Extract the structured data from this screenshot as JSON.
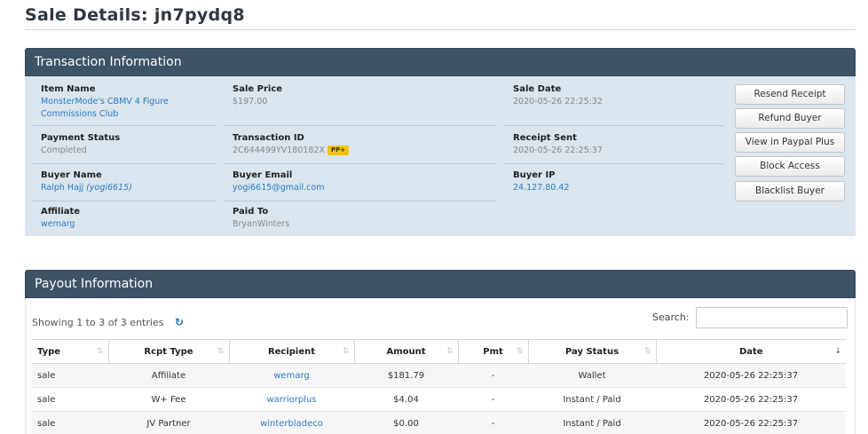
{
  "page": {
    "title": "Sale Details: jn7pydq8"
  },
  "transaction": {
    "header": "Transaction Information",
    "item_name": {
      "label": "Item Name",
      "value": "MonsterMode's CBMV 4 Figure Commissions Club"
    },
    "sale_price": {
      "label": "Sale Price",
      "value": "$197.00"
    },
    "sale_date": {
      "label": "Sale Date",
      "value": "2020-05-26 22:25:32"
    },
    "payment_status": {
      "label": "Payment Status",
      "value": "Completed"
    },
    "transaction_id": {
      "label": "Transaction ID",
      "value": "2C644499YV180182X",
      "badge": "PP+"
    },
    "receipt_sent": {
      "label": "Receipt Sent",
      "value": "2020-05-26 22:25:37"
    },
    "buyer_name": {
      "label": "Buyer Name",
      "value": "Ralph Hajj",
      "username": "(yogi6615)"
    },
    "buyer_email": {
      "label": "Buyer Email",
      "value": "yogi6615@gmail.com"
    },
    "buyer_ip": {
      "label": "Buyer IP",
      "value": "24.127.80.42"
    },
    "affiliate": {
      "label": "Affiliate",
      "value": "wemarg"
    },
    "paid_to": {
      "label": "Paid To",
      "value": "BryanWinters"
    },
    "actions": {
      "resend_receipt": "Resend Receipt",
      "refund_buyer": "Refund Buyer",
      "view_paypal_plus": "View in Paypal Plus",
      "block_access": "Block Access",
      "blacklist_buyer": "Blacklist Buyer"
    }
  },
  "payout": {
    "header": "Payout Information",
    "showing_text": "Showing 1 to 3 of 3 entries",
    "search_label": "Search:",
    "search_value": "",
    "columns": [
      "Type",
      "Rcpt Type",
      "Recipient",
      "Amount",
      "Pmt",
      "Pay Status",
      "Date"
    ],
    "rows": [
      {
        "type": "sale",
        "rcpt_type": "Affiliate",
        "recipient": "wemarg",
        "amount": "$181.79",
        "pmt": "-",
        "pay_status": "Wallet",
        "date": "2020-05-26 22:25:37"
      },
      {
        "type": "sale",
        "rcpt_type": "W+ Fee",
        "recipient": "warriorplus",
        "amount": "$4.04",
        "pmt": "-",
        "pay_status": "Instant / Paid",
        "date": "2020-05-26 22:25:37"
      },
      {
        "type": "sale",
        "rcpt_type": "JV Partner",
        "recipient": "winterbladeco",
        "amount": "$0.00",
        "pmt": "-",
        "pay_status": "Instant / Paid",
        "date": "2020-05-26 22:25:37"
      }
    ]
  },
  "icons": {
    "refresh": "refresh-icon",
    "sort": "sort-icon",
    "sort_desc": "sort-desc-icon"
  },
  "colors": {
    "panel_header": "#3e5366",
    "panel_body": "#dae5ee",
    "link": "#2a7bc4",
    "badge": "#f4c20d"
  }
}
